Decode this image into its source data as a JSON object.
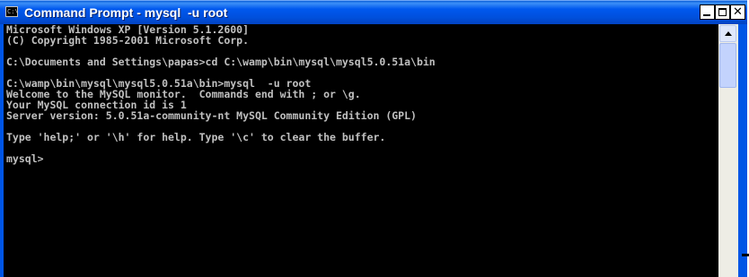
{
  "window": {
    "title": "Command Prompt - mysql  -u root",
    "icon_label": "C:\\",
    "icons": {
      "app": "command-prompt-icon",
      "minimize": "minimize-icon",
      "maximize": "maximize-icon",
      "close": "close-icon"
    },
    "colors": {
      "titlebar": "#0055e5",
      "console_background": "#000000",
      "console_text": "#c0c0c0"
    }
  },
  "controls": {
    "close_glyph": "✕"
  },
  "console": {
    "lines": [
      "Microsoft Windows XP [Version 5.1.2600]",
      "(C) Copyright 1985-2001 Microsoft Corp.",
      "",
      "C:\\Documents and Settings\\papas>cd C:\\wamp\\bin\\mysql\\mysql5.0.51a\\bin",
      "",
      "C:\\wamp\\bin\\mysql\\mysql5.0.51a\\bin>mysql  -u root",
      "Welcome to the MySQL monitor.  Commands end with ; or \\g.",
      "Your MySQL connection id is 1",
      "Server version: 5.0.51a-community-nt MySQL Community Edition (GPL)",
      "",
      "Type 'help;' or '\\h' for help. Type '\\c' to clear the buffer.",
      "",
      "mysql>"
    ]
  }
}
